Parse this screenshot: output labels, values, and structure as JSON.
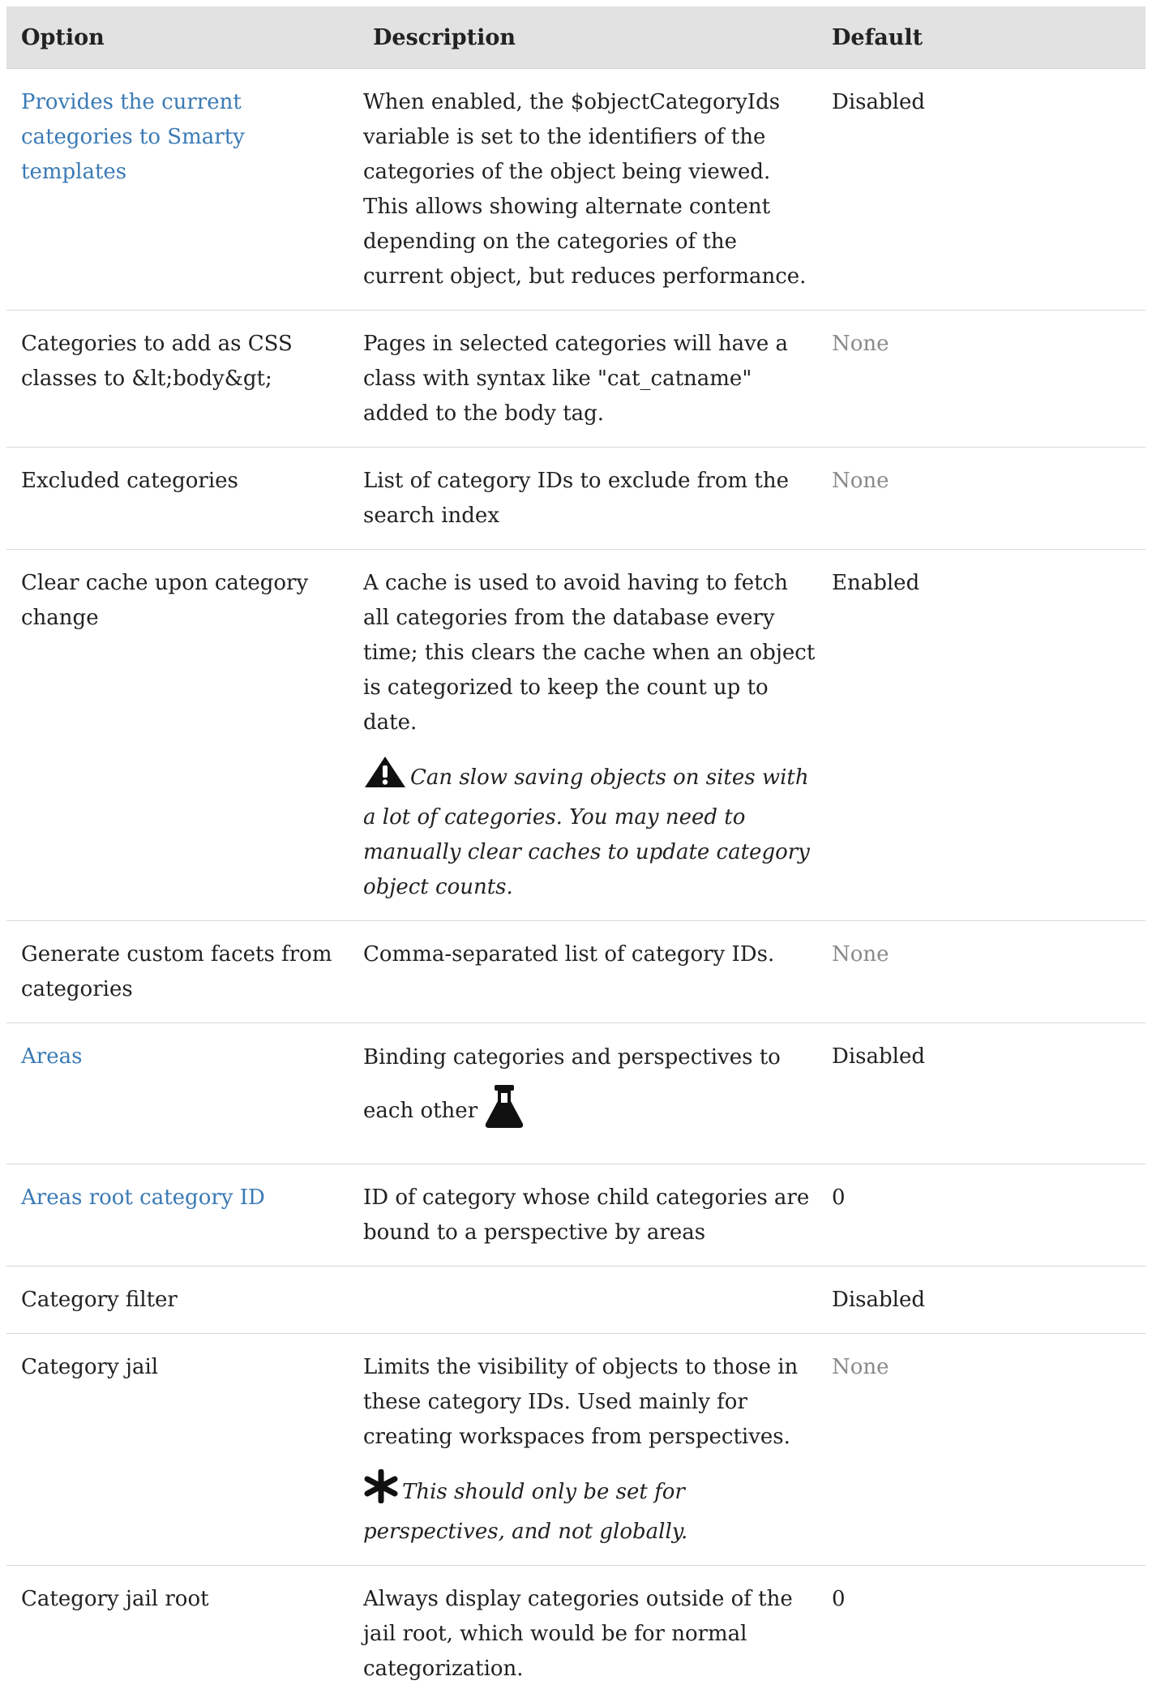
{
  "table": {
    "headers": {
      "option": "Option",
      "description": "Description",
      "default": "Default"
    },
    "rows": [
      {
        "option": "Provides the current categories to Smarty templates",
        "description": "When enabled, the $objectCategoryIds variable is set to the identifiers of the categories of the object being viewed. This allows showing alternate content depending on the categories of the current object, but reduces performance.",
        "default": "Disabled"
      },
      {
        "option": "Categories to add as CSS classes to &lt;body&gt;",
        "description": "Pages in selected categories will have a class with syntax like \"cat_catname\" added to the body tag.",
        "default": "None"
      },
      {
        "option": "Excluded categories",
        "description": "List of category IDs to exclude from the search index",
        "default": "None"
      },
      {
        "option": "Clear cache upon category change",
        "description": "A cache is used to avoid having to fetch all categories from the database every time; this clears the cache when an object is categorized to keep the count up to date.",
        "note": "Can slow saving objects on sites with a lot of categories. You may need to manually clear caches to update category object counts.",
        "note_icon": "warning-icon",
        "default": "Enabled"
      },
      {
        "option": "Generate custom facets from categories",
        "description": "Comma-separated list of category IDs.",
        "default": "None"
      },
      {
        "option": "Areas",
        "description": "Binding categories and perspectives to each other",
        "desc_icon": "flask-icon",
        "default": "Disabled"
      },
      {
        "option": "Areas root category ID",
        "description": "ID of category whose child categories are bound to a perspective by areas",
        "default": "0"
      },
      {
        "option": "Category filter",
        "description": "",
        "default": "Disabled"
      },
      {
        "option": "Category jail",
        "description": "Limits the visibility of objects to those in these category IDs. Used mainly for creating workspaces from perspectives.",
        "note": "This should only be set for perspectives, and not globally.",
        "note_icon": "asterisk-icon",
        "default": "None"
      },
      {
        "option": "Category jail root",
        "description": "Always display categories outside of the jail root, which would be for normal categorization.",
        "default": "0"
      }
    ]
  },
  "colors": {
    "link": "#3a7ab5",
    "header_bg": "#e2e2e2",
    "muted": "#8a8a8a"
  }
}
